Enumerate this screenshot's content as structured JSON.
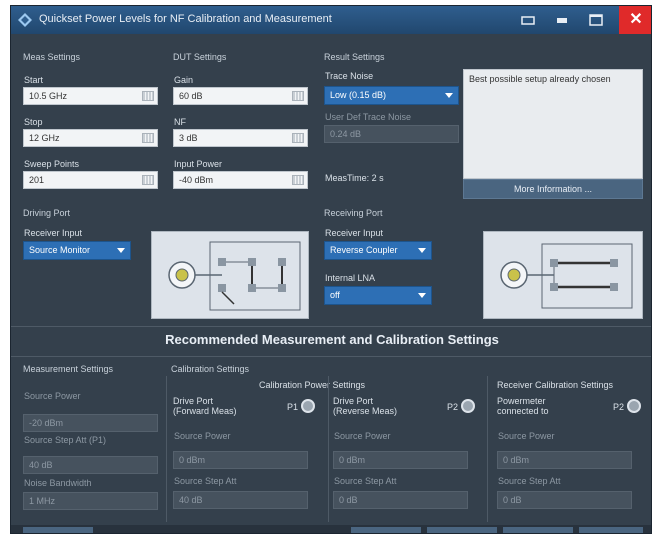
{
  "window": {
    "title": "Quickset Power Levels for NF Calibration and Measurement",
    "close_label": "✕"
  },
  "meas": {
    "header": "Meas Settings",
    "start_label": "Start",
    "start_value": "10.5 GHz",
    "stop_label": "Stop",
    "stop_value": "12 GHz",
    "points_label": "Sweep Points",
    "points_value": "201"
  },
  "dut": {
    "header": "DUT Settings",
    "gain_label": "Gain",
    "gain_value": "60 dB",
    "nf_label": "NF",
    "nf_value": "3 dB",
    "input_label": "Input Power",
    "input_value": "-40 dBm"
  },
  "result": {
    "header": "Result Settings",
    "trace_noise_label": "Trace Noise",
    "trace_noise_value": "Low (0.15 dB)",
    "user_noise_label": "User Def Trace Noise",
    "user_noise_value": "0.24 dB",
    "meas_time": "MeasTime: 2 s",
    "info_text": "Best possible setup already chosen",
    "more_button": "More Information ..."
  },
  "driving": {
    "header": "Driving Port",
    "receiver_label": "Receiver Input",
    "receiver_value": "Source Monitor"
  },
  "receiving": {
    "header": "Receiving Port",
    "receiver_label": "Receiver Input",
    "receiver_value": "Reverse Coupler",
    "lna_label": "Internal LNA",
    "lna_value": "off"
  },
  "recommended": {
    "title": "Recommended Measurement and Calibration Settings",
    "meas_header": "Measurement Settings",
    "source_power_label": "Source Power",
    "source_power_value": "-20 dBm",
    "source_att_label": "Source Step Att (P1)",
    "source_att_value": "40 dB",
    "noise_bw_label": "Noise Bandwidth",
    "noise_bw_value": "1 MHz",
    "cal_header": "Calibration Settings",
    "cal_power_header": "Calibration Power Settings",
    "drive_fwd": "Drive Port\n(Forward Meas)",
    "drive_fwd_port": "P1",
    "fwd_power_label": "Source Power",
    "fwd_power_value": "0 dBm",
    "fwd_att_label": "Source Step Att",
    "fwd_att_value": "40 dB",
    "drive_rev": "Drive Port\n(Reverse Meas)",
    "drive_rev_port": "P2",
    "rev_power_label": "Source Power",
    "rev_power_value": "0 dBm",
    "rev_att_label": "Source Step Att",
    "rev_att_value": "0 dB",
    "receiver_cal_header": "Receiver Calibration Settings",
    "powermeter_label": "Powermeter\nconnected to",
    "powermeter_port": "P2",
    "rc_power_label": "Source Power",
    "rc_power_value": "0 dBm",
    "rc_att_label": "Source Step Att",
    "rc_att_value": "0 dB"
  },
  "colors": {
    "accent": "#2d6fb5",
    "background": "#34404c",
    "close": "#e02a2a"
  }
}
